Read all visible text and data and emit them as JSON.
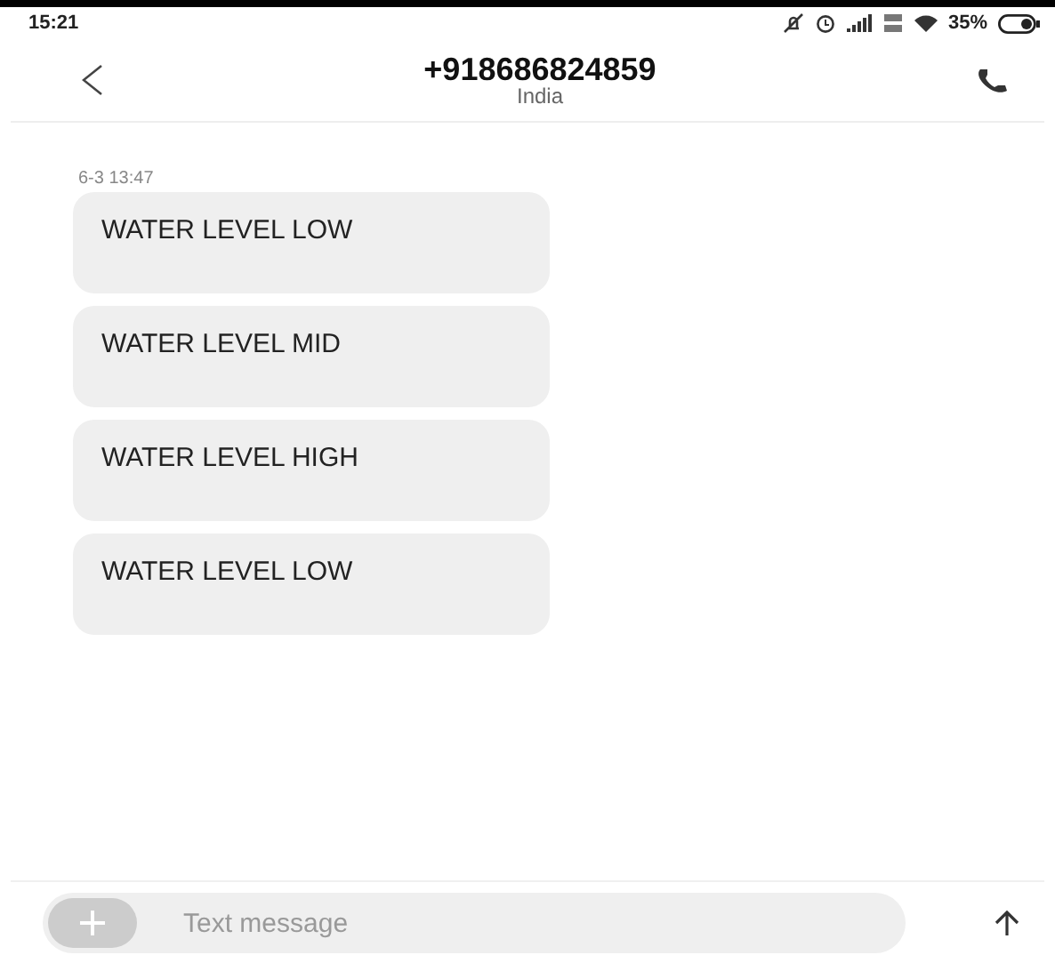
{
  "status_bar": {
    "time": "15:21",
    "battery": "35%"
  },
  "header": {
    "title": "+918686824859",
    "subtitle": "India"
  },
  "timestamp": "6-3 13:47",
  "messages": [
    {
      "text": "WATER LEVEL LOW"
    },
    {
      "text": "WATER LEVEL MID"
    },
    {
      "text": "WATER LEVEL HIGH"
    },
    {
      "text": "WATER LEVEL LOW"
    }
  ],
  "composer": {
    "placeholder": "Text message"
  }
}
